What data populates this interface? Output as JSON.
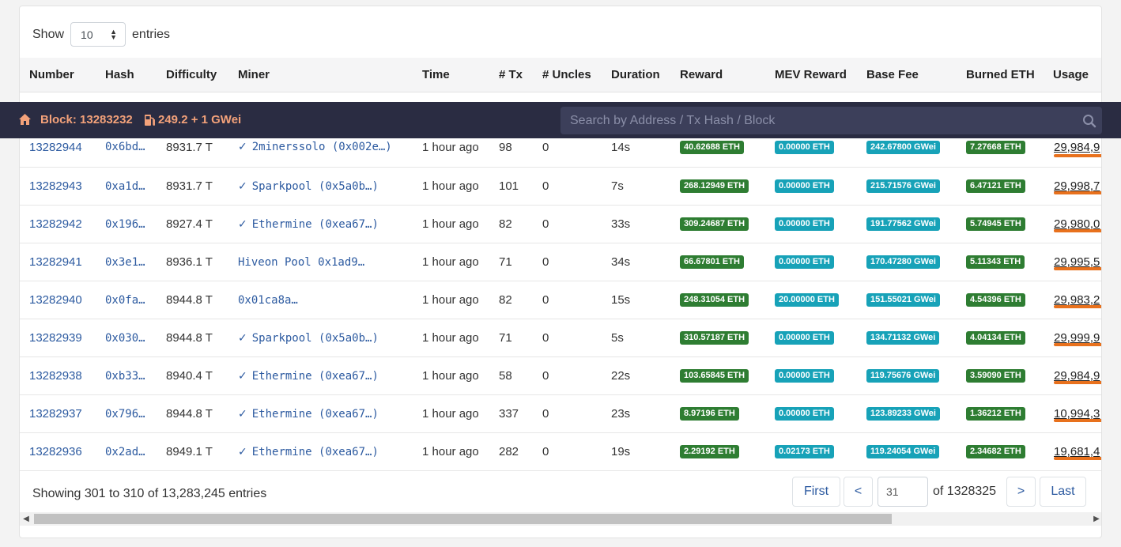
{
  "length_menu": {
    "show_label": "Show",
    "value": "10",
    "entries_label": "entries"
  },
  "columns": [
    "Number",
    "Hash",
    "Difficulty",
    "Miner",
    "Time",
    "# Tx",
    "# Uncles",
    "Duration",
    "Reward",
    "MEV Reward",
    "Base Fee",
    "Burned ETH",
    "Usage"
  ],
  "rows": [
    {
      "number": "13282944",
      "hash": "0x6bd…",
      "difficulty": "8931.7 T",
      "verified": true,
      "miner": "2minerssolo (0x002e…)",
      "time": "1 hour ago",
      "tx": "98",
      "uncles": "0",
      "duration": "14s",
      "reward": "40.62688 ETH",
      "mev": "0.00000 ETH",
      "base_fee": "242.67800 GWei",
      "burned": "7.27668 ETH",
      "usage": "29,984,9"
    },
    {
      "number": "13282943",
      "hash": "0xa1d…",
      "difficulty": "8931.7 T",
      "verified": true,
      "miner": "Sparkpool (0x5a0b…)",
      "time": "1 hour ago",
      "tx": "101",
      "uncles": "0",
      "duration": "7s",
      "reward": "268.12949 ETH",
      "mev": "0.00000 ETH",
      "base_fee": "215.71576 GWei",
      "burned": "6.47121 ETH",
      "usage": "29,998,7"
    },
    {
      "number": "13282942",
      "hash": "0x196…",
      "difficulty": "8927.4 T",
      "verified": true,
      "miner": "Ethermine (0xea67…)",
      "time": "1 hour ago",
      "tx": "82",
      "uncles": "0",
      "duration": "33s",
      "reward": "309.24687 ETH",
      "mev": "0.00000 ETH",
      "base_fee": "191.77562 GWei",
      "burned": "5.74945 ETH",
      "usage": "29,980,0"
    },
    {
      "number": "13282941",
      "hash": "0x3e1…",
      "difficulty": "8936.1 T",
      "verified": false,
      "miner": "Hiveon Pool 0x1ad9…",
      "time": "1 hour ago",
      "tx": "71",
      "uncles": "0",
      "duration": "34s",
      "reward": "66.67801 ETH",
      "mev": "0.00000 ETH",
      "base_fee": "170.47280 GWei",
      "burned": "5.11343 ETH",
      "usage": "29,995,5"
    },
    {
      "number": "13282940",
      "hash": "0x0fa…",
      "difficulty": "8944.8 T",
      "verified": false,
      "miner": "0x01ca8a…",
      "time": "1 hour ago",
      "tx": "82",
      "uncles": "0",
      "duration": "15s",
      "reward": "248.31054 ETH",
      "mev": "20.00000 ETH",
      "base_fee": "151.55021 GWei",
      "burned": "4.54396 ETH",
      "usage": "29,983,2"
    },
    {
      "number": "13282939",
      "hash": "0x030…",
      "difficulty": "8944.8 T",
      "verified": true,
      "miner": "Sparkpool (0x5a0b…)",
      "time": "1 hour ago",
      "tx": "71",
      "uncles": "0",
      "duration": "5s",
      "reward": "310.57187 ETH",
      "mev": "0.00000 ETH",
      "base_fee": "134.71132 GWei",
      "burned": "4.04134 ETH",
      "usage": "29,999,9"
    },
    {
      "number": "13282938",
      "hash": "0xb33…",
      "difficulty": "8940.4 T",
      "verified": true,
      "miner": "Ethermine (0xea67…)",
      "time": "1 hour ago",
      "tx": "58",
      "uncles": "0",
      "duration": "22s",
      "reward": "103.65845 ETH",
      "mev": "0.00000 ETH",
      "base_fee": "119.75676 GWei",
      "burned": "3.59090 ETH",
      "usage": "29,984,9"
    },
    {
      "number": "13282937",
      "hash": "0x796…",
      "difficulty": "8944.8 T",
      "verified": true,
      "miner": "Ethermine (0xea67…)",
      "time": "1 hour ago",
      "tx": "337",
      "uncles": "0",
      "duration": "23s",
      "reward": "8.97196 ETH",
      "mev": "0.00000 ETH",
      "base_fee": "123.89233 GWei",
      "burned": "1.36212 ETH",
      "usage": "10,994,3"
    },
    {
      "number": "13282936",
      "hash": "0x2ad…",
      "difficulty": "8949.1 T",
      "verified": true,
      "miner": "Ethermine (0xea67…)",
      "time": "1 hour ago",
      "tx": "282",
      "uncles": "0",
      "duration": "19s",
      "reward": "2.29192 ETH",
      "mev": "0.02173 ETH",
      "base_fee": "119.24054 GWei",
      "burned": "2.34682 ETH",
      "usage": "19,681,4"
    }
  ],
  "footer": {
    "info": "Showing 301 to 310 of 13,283,245 entries"
  },
  "pagination": {
    "first": "First",
    "prev": "<",
    "page": "31",
    "of_label": "of 1328325",
    "next": ">",
    "last": "Last"
  },
  "topbar": {
    "block": "Block: 13283232",
    "gas": "249.2 + 1 GWei",
    "search_placeholder": "Search by Address / Tx Hash / Block"
  },
  "colors": {
    "navbar": "#2a2c42",
    "accent_orange": "#f4a27a",
    "badge_green": "#2e7d32",
    "badge_teal": "#17a2b8",
    "usage_bar": "#e8711d",
    "link": "#2c5aa0"
  }
}
